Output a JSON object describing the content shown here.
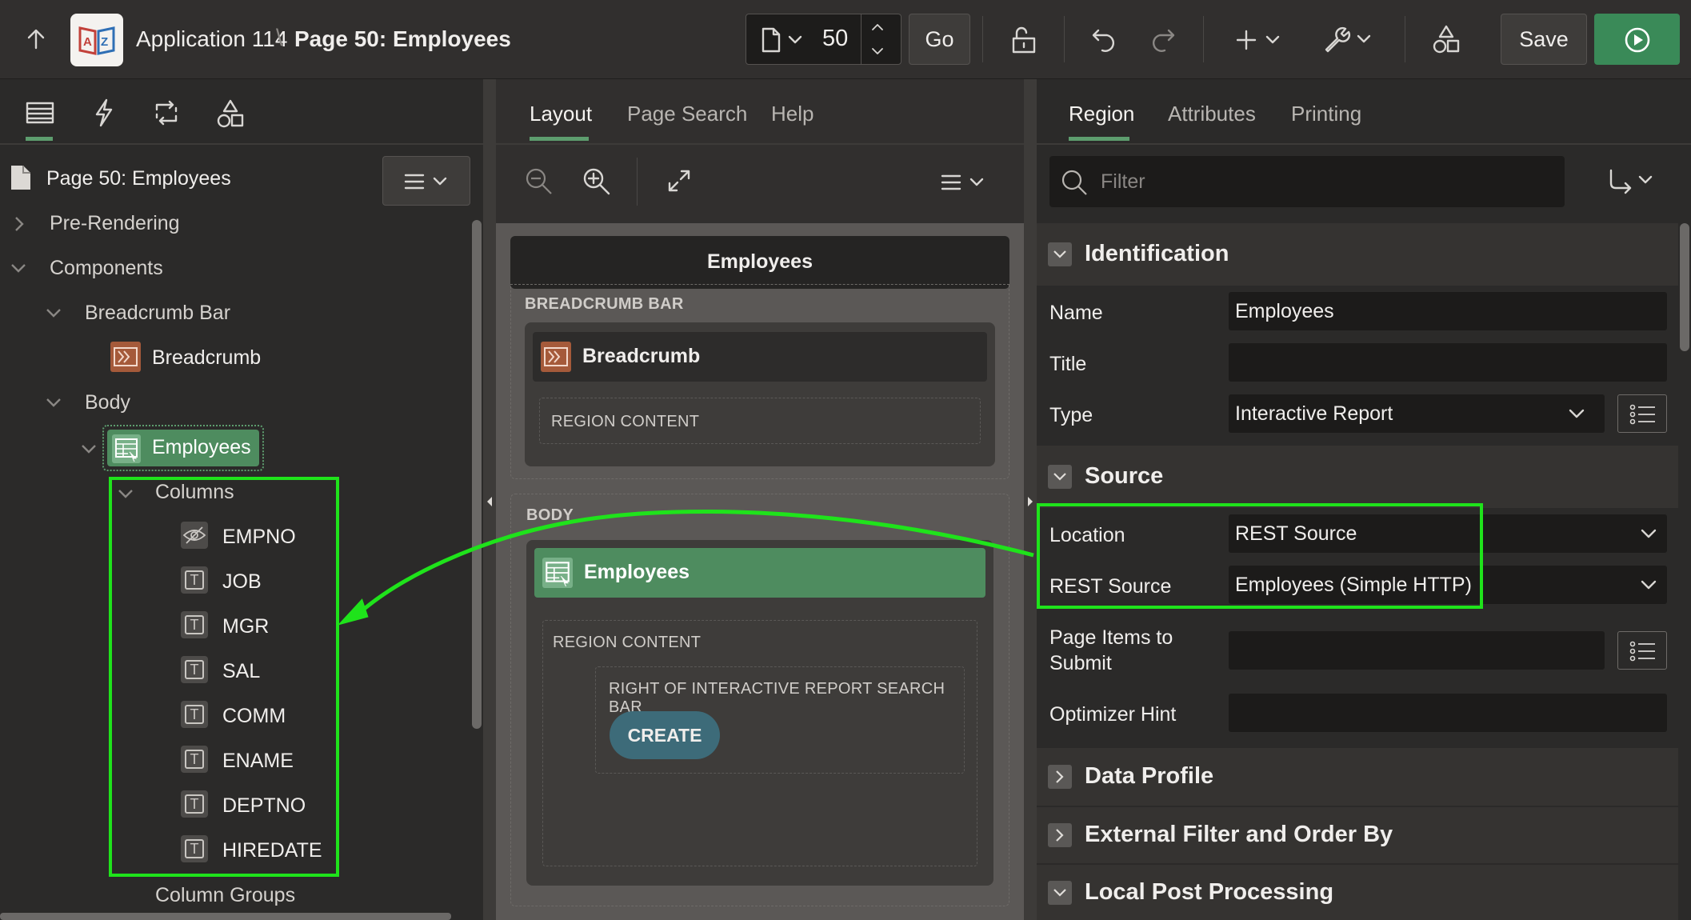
{
  "header": {
    "app_name": "Application 114",
    "separator": "\\",
    "page_title": "Page 50: Employees",
    "page_number": "50",
    "go_label": "Go",
    "save_label": "Save"
  },
  "left_panel": {
    "page_node": "Page 50: Employees",
    "tree": {
      "pre_rendering": "Pre-Rendering",
      "components": "Components",
      "breadcrumb_bar": "Breadcrumb Bar",
      "breadcrumb": "Breadcrumb",
      "body": "Body",
      "employees": "Employees",
      "columns": "Columns",
      "column_items": [
        "EMPNO",
        "JOB",
        "MGR",
        "SAL",
        "COMM",
        "ENAME",
        "DEPTNO",
        "HIREDATE"
      ],
      "column_groups": "Column Groups"
    }
  },
  "middle_panel": {
    "tabs": [
      "Layout",
      "Page Search",
      "Help"
    ],
    "page_title": "Employees",
    "breadcrumb_bar_label": "BREADCRUMB BAR",
    "breadcrumb_region": "Breadcrumb",
    "region_content": "REGION CONTENT",
    "body_label": "BODY",
    "employees_region": "Employees",
    "region_content_2": "REGION CONTENT",
    "right_of_search": "RIGHT OF INTERACTIVE REPORT SEARCH BAR",
    "create_button": "CREATE"
  },
  "right_panel": {
    "tabs": [
      "Region",
      "Attributes",
      "Printing"
    ],
    "filter_placeholder": "Filter",
    "identification": {
      "title": "Identification",
      "name_label": "Name",
      "name_value": "Employees",
      "title_label": "Title",
      "title_value": "",
      "type_label": "Type",
      "type_value": "Interactive Report"
    },
    "source": {
      "title": "Source",
      "location_label": "Location",
      "location_value": "REST Source",
      "rest_source_label": "REST Source",
      "rest_source_value": "Employees (Simple HTTP)",
      "page_items_label_1": "Page Items to",
      "page_items_label_2": "Submit",
      "optimizer_label": "Optimizer Hint"
    },
    "sections": {
      "data_profile": "Data Profile",
      "external_filter": "External Filter and Order By",
      "local_post": "Local Post Processing"
    }
  },
  "colors": {
    "accent_green": "#5d9d6e",
    "highlight_green": "#1fe31b",
    "breadcrumb_orange": "#a55a3a",
    "create_teal": "#3d6b79",
    "save_run_green": "#3a8a58"
  }
}
